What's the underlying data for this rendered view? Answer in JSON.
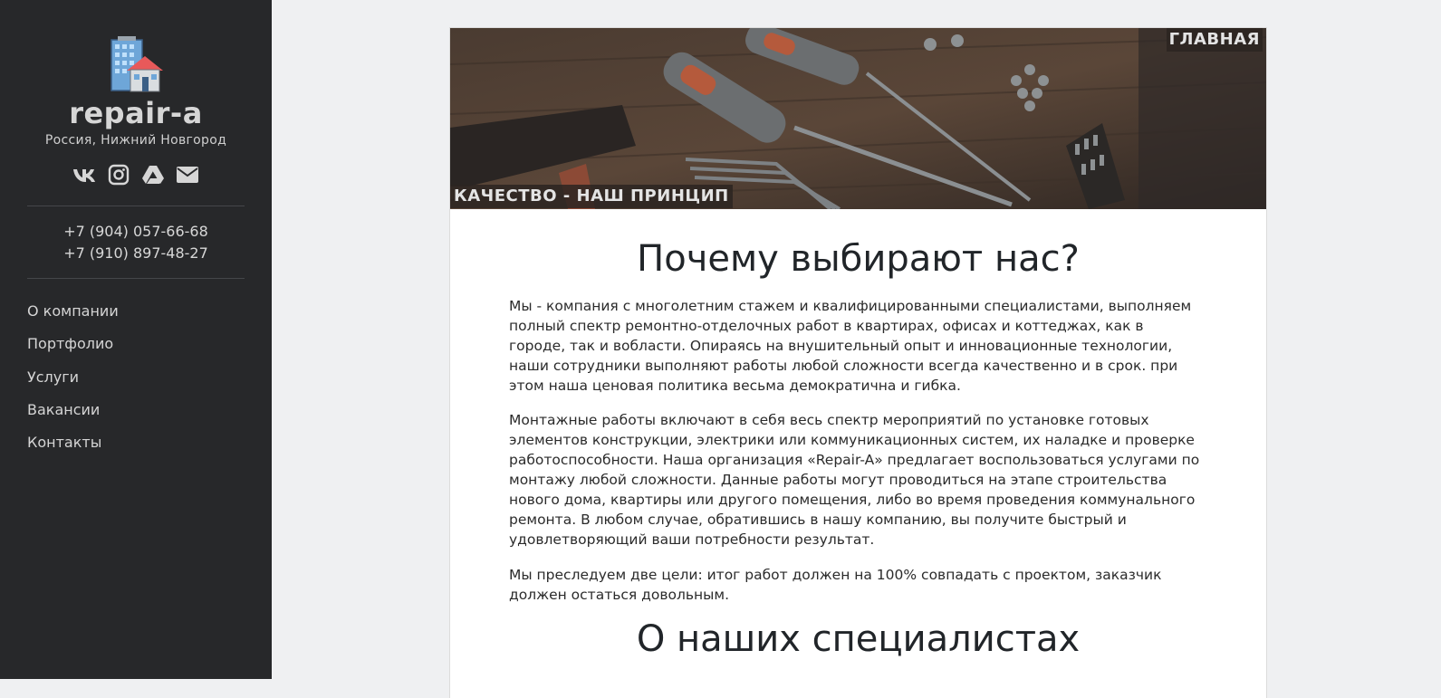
{
  "sidebar": {
    "brand": "repair-a",
    "location": "Россия, Нижний Новгород",
    "socials": [
      {
        "icon": "vk-icon"
      },
      {
        "icon": "instagram-icon"
      },
      {
        "icon": "google-drive-icon"
      },
      {
        "icon": "envelope-icon"
      }
    ],
    "phones": [
      "+7 (904) 057-66-68",
      "+7 (910) 897-48-27"
    ],
    "nav": [
      "О компании",
      "Портфолио",
      "Услуги",
      "Вакансии",
      "Контакты"
    ]
  },
  "hero": {
    "page_label": "ГЛАВНАЯ",
    "motto": "КАЧЕСТВО - НАШ ПРИНЦИП"
  },
  "content": {
    "heading1": "Почему выбирают нас?",
    "paragraphs": [
      "Мы - компания с многолетним стажем и квалифицированными специалистами, выполняем полный спектр ремонтно-отделочных работ в квартирах, офисах и коттеджах, как в городе, так и вобласти. Опираясь на внушительный опыт и инновационные технологии, наши сотрудники выполняют работы любой сложности всегда качественно и в срок. при этом наша ценовая политика весьма демократична и гибка.",
      "Монтажные работы включают в себя весь спектр мероприятий по установке готовых элементов конструкции, электрики или коммуникационных систем, их наладке и проверке работоспособности. Наша организация «Repair-A» предлагает воспользоваться услугами по монтажу любой сложности. Данные работы могут проводиться на этапе строительства нового дома, квартиры или другого помещения, либо во время проведения коммунального ремонта. В любом случае, обратившись в нашу компанию, вы получите быстрый и удовлетворяющий ваши потребности результат.",
      "Мы преследуем две цели: итог работ должен на 100% совпадать с проектом, заказчик должен остаться довольным."
    ],
    "heading2": "О наших специалистах"
  },
  "colors": {
    "sidebar_bg": "#27282a",
    "page_bg": "#eff0f2",
    "accent_roof": "#e8595a"
  }
}
